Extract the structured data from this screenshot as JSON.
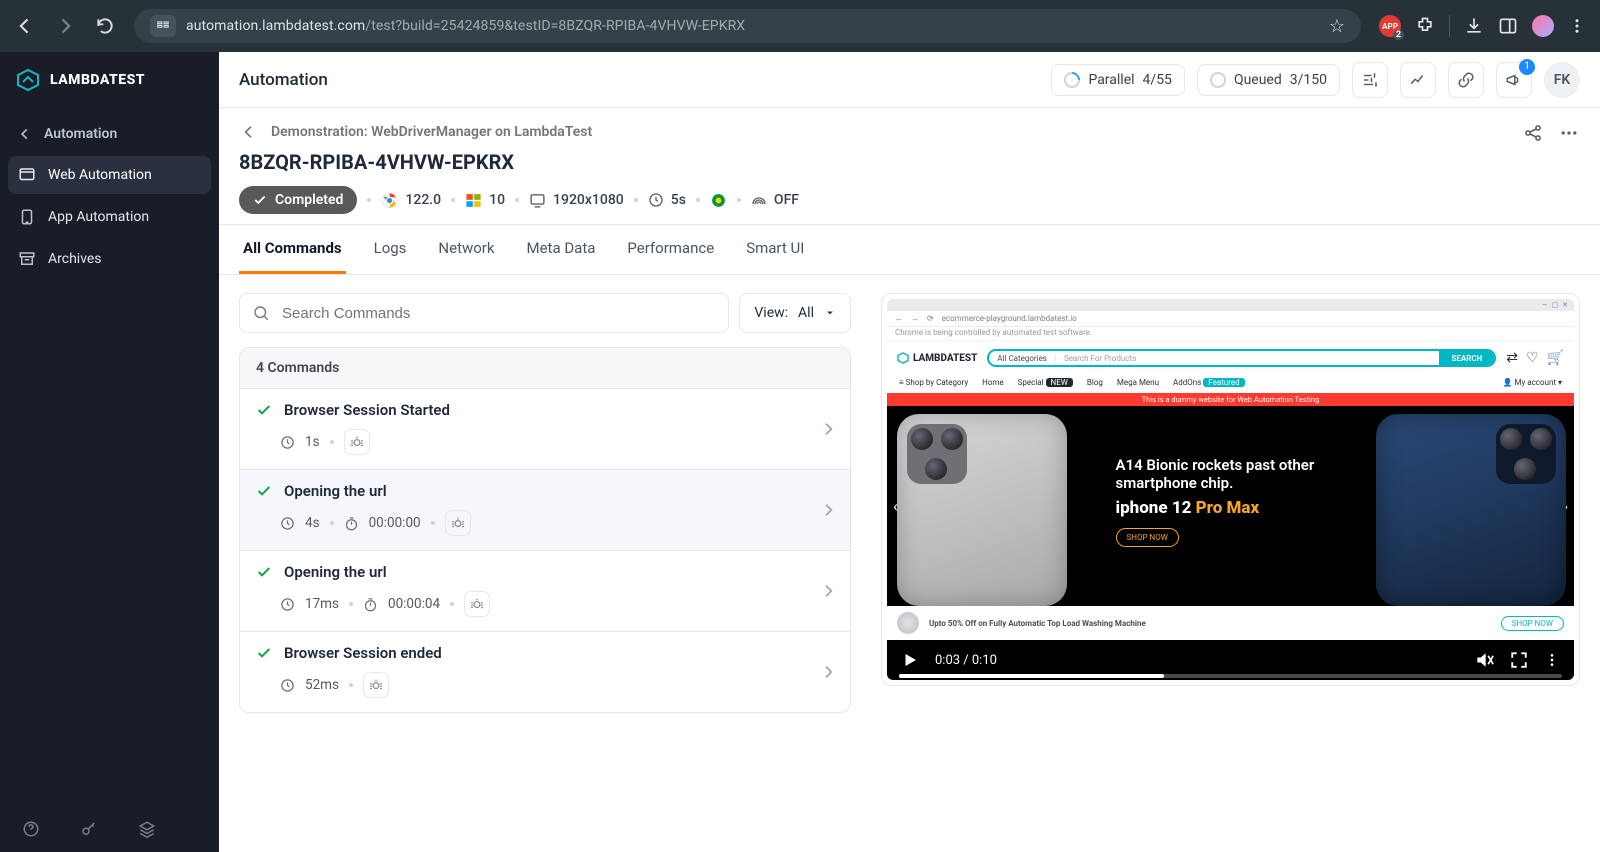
{
  "chrome": {
    "url_host": "automation.lambdatest.com",
    "url_path": "/test?build=25424859&testID=8BZQR-RPIBA-4VHVW-EPKRX",
    "ext_badge": "2"
  },
  "sidebar": {
    "brand": "LAMBDATEST",
    "back_label": "Automation",
    "items": [
      {
        "label": "Web Automation"
      },
      {
        "label": "App Automation"
      },
      {
        "label": "Archives"
      }
    ]
  },
  "topbar": {
    "title": "Automation",
    "parallel_label": "Parallel",
    "parallel_value": "4/55",
    "queued_label": "Queued",
    "queued_value": "3/150",
    "notif_count": "1",
    "user_initials": "FK"
  },
  "header": {
    "breadcrumb": "Demonstration: WebDriverManager on LambdaTest",
    "test_id": "8BZQR-RPIBA-4VHVW-EPKRX",
    "status": "Completed",
    "browser_version": "122.0",
    "os_version": "10",
    "resolution": "1920x1080",
    "duration": "5s",
    "video_flag": "OFF"
  },
  "tabs": [
    "All Commands",
    "Logs",
    "Network",
    "Meta Data",
    "Performance",
    "Smart UI"
  ],
  "toolbar": {
    "search_placeholder": "Search Commands",
    "view_label": "View:",
    "view_value": "All"
  },
  "commands": {
    "count_text": "4 Commands",
    "items": [
      {
        "name": "Browser Session Started",
        "t": "1s",
        "ts": null
      },
      {
        "name": "Opening the url",
        "t": "4s",
        "ts": "00:00:00"
      },
      {
        "name": "Opening the url",
        "t": "17ms",
        "ts": "00:00:04"
      },
      {
        "name": "Browser Session ended",
        "t": "52ms",
        "ts": null
      }
    ]
  },
  "video": {
    "window_url": "ecommerce-playground.lambdatest.io",
    "chrome_note": "Chrome is being controlled by automated test software.",
    "store_brand": "LAMBDATEST",
    "search_cat": "All Categories",
    "search_placeholder": "Search For Products",
    "search_go": "SEARCH",
    "nav": [
      "Shop by Category",
      "Home",
      "Special",
      "Blog",
      "Mega Menu",
      "AddOns",
      "My account"
    ],
    "nav_new": "NEW",
    "nav_featured": "Featured",
    "red_strip": "This is a dummy website for Web Automation Testing",
    "hero_line": "A14 Bionic rockets past other smartphone chip.",
    "hero_product": "iphone 12",
    "hero_product_suffix": "Pro Max",
    "shop_now": "SHOP NOW",
    "promo_text": "Upto 50% Off on Fully Automatic Top Load Washing Machine",
    "promo_cta": "SHOP NOW",
    "time": "0:03 / 0:10"
  }
}
